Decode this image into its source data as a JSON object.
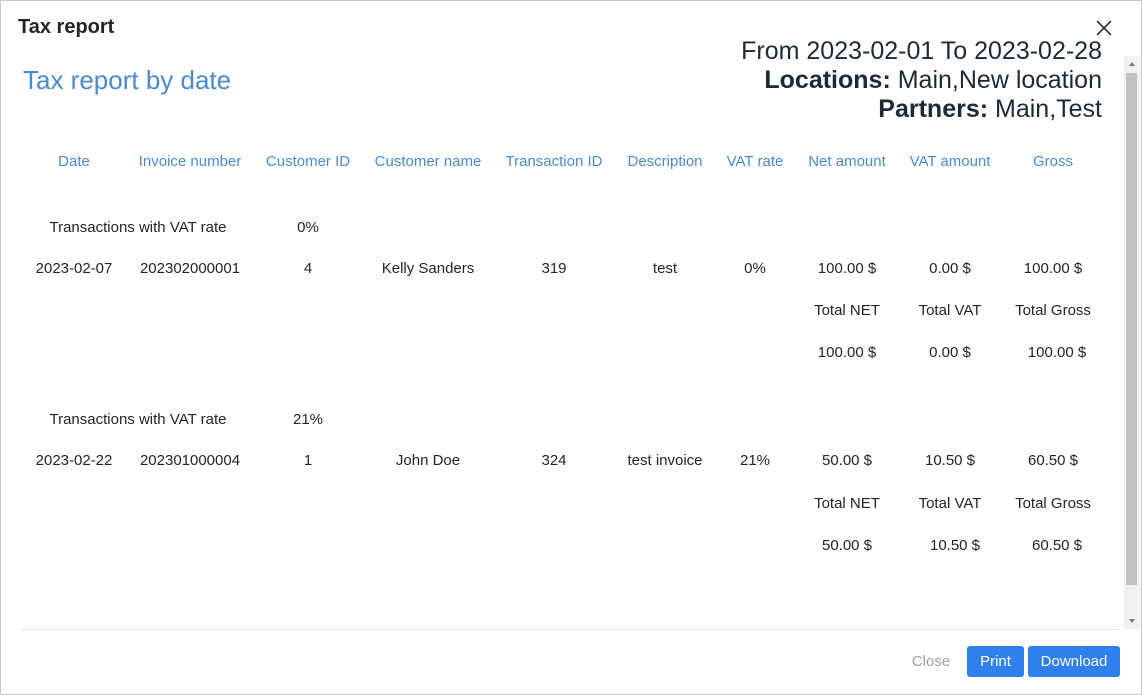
{
  "modal": {
    "title": "Tax report",
    "close_icon": "close-icon"
  },
  "report": {
    "title": "Tax report by date",
    "range_text": "From 2023-02-01 To 2023-02-28",
    "locations_label": "Locations:",
    "locations_value": " Main,New location",
    "partners_label": "Partners:",
    "partners_value": " Main,Test"
  },
  "columns": [
    "Date",
    "Invoice number",
    "Customer ID",
    "Customer name",
    "Transaction ID",
    "Description",
    "VAT rate",
    "Net amount",
    "VAT amount",
    "Gross"
  ],
  "groups": [
    {
      "label": "Transactions with VAT rate",
      "rate": "0%",
      "rows": [
        {
          "date": "2023-02-07",
          "invoice": "202302000001",
          "customer_id": "4",
          "customer_name": "Kelly Sanders",
          "transaction_id": "319",
          "description": "test",
          "vat_rate": "0%",
          "net": "100.00 $",
          "vat": "0.00 $",
          "gross": "100.00 $"
        }
      ],
      "totals_labels": {
        "net": "Total NET",
        "vat": "Total VAT",
        "gross": "Total Gross"
      },
      "totals": {
        "net": "100.00 $",
        "vat": "0.00 $",
        "gross": "100.00 $"
      }
    },
    {
      "label": "Transactions with VAT rate",
      "rate": "21%",
      "rows": [
        {
          "date": "2023-02-22",
          "invoice": "202301000004",
          "customer_id": "1",
          "customer_name": "John Doe",
          "transaction_id": "324",
          "description": "test invoice",
          "vat_rate": "21%",
          "net": "50.00 $",
          "vat": "10.50 $",
          "gross": "60.50 $"
        }
      ],
      "totals_labels": {
        "net": "Total NET",
        "vat": "Total VAT",
        "gross": "Total Gross"
      },
      "totals": {
        "net": "50.00 $",
        "vat": "10.50 $",
        "gross": "60.50 $"
      }
    }
  ],
  "footer": {
    "close_label": "Close",
    "print_label": "Print",
    "download_label": "Download"
  },
  "colors": {
    "accent": "#2f80ed",
    "link_blue": "#4a8bd0",
    "muted": "#9aa0a6"
  }
}
